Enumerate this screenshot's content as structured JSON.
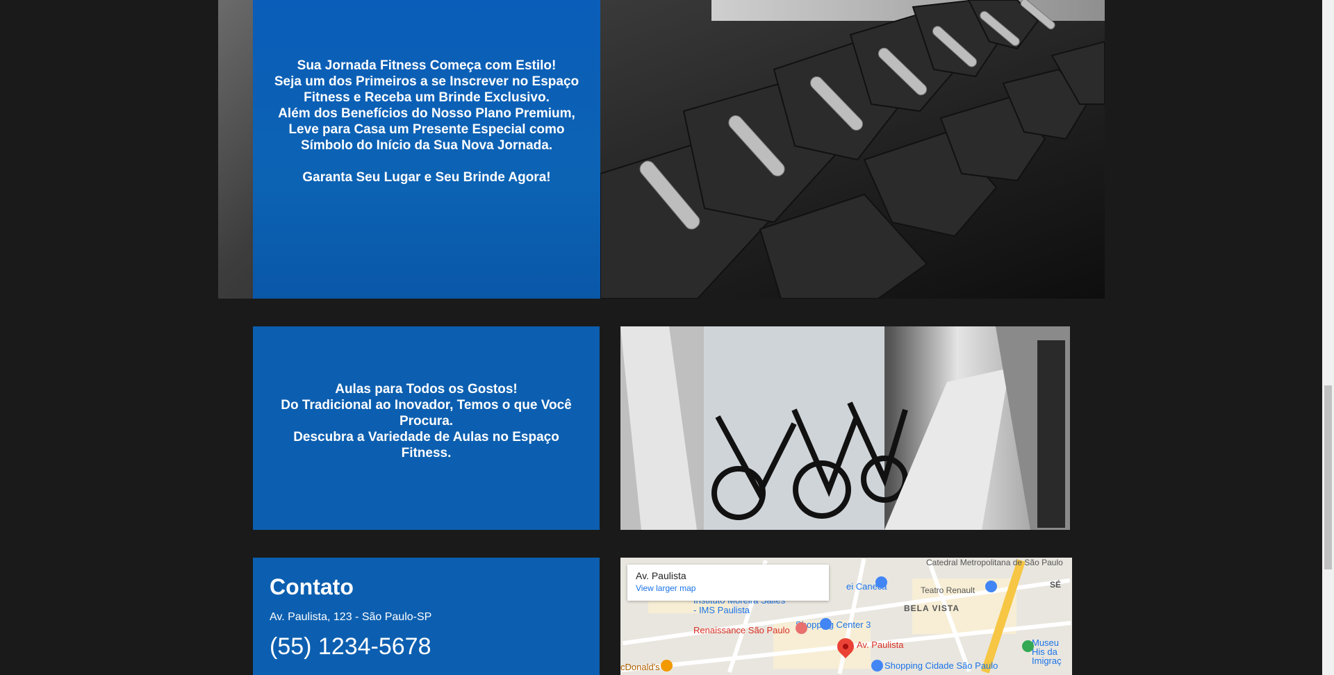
{
  "promo": {
    "text": "Sua Jornada Fitness Começa com Estilo!\nSeja um dos Primeiros a se Inscrever no Espaço Fitness e Receba um Brinde Exclusivo.\nAlém dos Benefícios do Nosso Plano Premium, Leve para Casa um Presente Especial como Símbolo do Início da Sua Nova Jornada.\n\nGaranta Seu Lugar e Seu Brinde Agora!"
  },
  "classes": {
    "text": "Aulas para Todos os Gostos!\nDo Tradicional ao Inovador, Temos o que Você Procura.\nDescubra a Variedade de Aulas no Espaço Fitness."
  },
  "contact": {
    "title": "Contato",
    "address": "Av. Paulista, 123 - São Paulo-SP",
    "phone": "(55) 1234-5678"
  },
  "map": {
    "place": "Av. Paulista",
    "link": "View larger map",
    "labels": {
      "catedral": "Catedral Metropolitana de São Paulo",
      "caneca": "ei Caneca",
      "teatro": "Teatro Renault",
      "se": "SÉ",
      "bela_vista": "BELA VISTA",
      "moreira": "Instituto Moreira Salles - IMS Paulista",
      "renaissance": "Renaissance São Paulo",
      "shopping_center": "Shopping Center 3",
      "pin_label": "Av. Paulista",
      "museu": "Museu His da Imigraç",
      "mcdonalds": "cDonald's",
      "shopping_cidade": "Shopping Cidade São Paulo"
    }
  },
  "colors": {
    "panel_blue": "#0c5fb0",
    "background": "#1a1a1a"
  }
}
